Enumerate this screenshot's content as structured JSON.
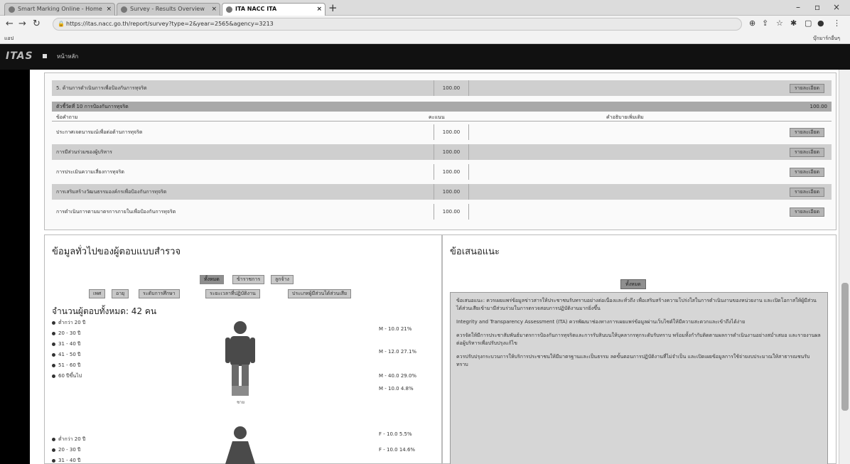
{
  "browser": {
    "tabs": [
      {
        "label": "Smart Marking Online - Home"
      },
      {
        "label": "Survey - Results Overview"
      },
      {
        "label": "ITA NACC ITA"
      }
    ],
    "url": "https://itas.nacc.go.th/report/survey?type=2&year=2565&agency=3213",
    "bookmark_left": "แอป",
    "bookmark_right": "บุ๊กมาร์กอื่นๆ"
  },
  "app": {
    "logo": "ITAS",
    "title": "หน้าหลัก"
  },
  "top_table": {
    "rows_a": [
      {
        "name": "5. ด้านการดำเนินการเพื่อป้องกันการทุจริต",
        "score": "100.00",
        "button": "รายละเอียด"
      }
    ],
    "section": {
      "title": "ตัวชี้วัดที่ 10 การป้องกันการทุจริต",
      "total": "100.00"
    },
    "columns": {
      "a": "ข้อคำถาม",
      "b": "คะแนน",
      "c": "คำอธิบายเพิ่มเติม"
    },
    "rows_b": [
      {
        "name": "ประกาศเจตนารมณ์เพื่อต่อต้านการทุจริต",
        "score": "100.00",
        "button": "รายละเอียด"
      },
      {
        "name": "การมีส่วนร่วมของผู้บริหาร",
        "score": "100.00",
        "button": "รายละเอียด"
      },
      {
        "name": "การประเมินความเสี่ยงการทุจริต",
        "score": "100.00",
        "button": "รายละเอียด"
      },
      {
        "name": "การเสริมสร้างวัฒนธรรมองค์กรเพื่อป้องกันการทุจริต",
        "score": "100.00",
        "button": "รายละเอียด"
      },
      {
        "name": "การดำเนินการตามมาตรการภายในเพื่อป้องกันการทุจริต",
        "score": "100.00",
        "button": "รายละเอียด"
      }
    ]
  },
  "left_panel": {
    "title": "ข้อมูลทั่วไปของผู้ตอบแบบสำรวจ",
    "filters_row1": [
      "ทั้งหมด",
      "ข้าราชการ",
      "ลูกจ้าง"
    ],
    "filters_row2": [
      "เพศ",
      "อายุ",
      "ระดับการศึกษา",
      "ระยะเวลาที่ปฏิบัติงาน",
      "ประเภทผู้มีส่วนได้ส่วนเสีย"
    ],
    "total_label": "จำนวนผู้ตอบทั้งหมด: 42 คน",
    "legend_male": [
      "ต่ำกว่า 20 ปี",
      "20 - 30 ปี",
      "31 - 40 ปี",
      "41 - 50 ปี",
      "51 - 60 ปี",
      "60 ปีขึ้นไป"
    ],
    "male_pcts": [
      "M - 10.0 21%",
      "M - 12.0 27.1%",
      "M - 40.0 29.0%",
      "M - 10.0 4.8%"
    ],
    "male_caption": "ชาย",
    "female_pcts": [
      "F - 10.0 5.5%",
      "F - 10.0 14.6%"
    ],
    "legend_female": [
      "ต่ำกว่า 20 ปี",
      "20 - 30 ปี",
      "31 - 40 ปี"
    ]
  },
  "right_panel": {
    "title": "ข้อเสนอแนะ",
    "button": "ทั้งหมด",
    "paragraphs": [
      "ข้อเสนอแนะ: ควรเผยแพร่ข้อมูลข่าวสารให้ประชาชนรับทราบอย่างต่อเนื่องและทั่วถึง เพื่อเสริมสร้างความโปร่งใสในการดำเนินงานของหน่วยงาน และเปิดโอกาสให้ผู้มีส่วนได้ส่วนเสียเข้ามามีส่วนร่วมในการตรวจสอบการปฏิบัติงานมากยิ่งขึ้น",
      "Integrity and Transparency Assessment (ITA) ควรพัฒนาช่องทางการเผยแพร่ข้อมูลผ่านเว็บไซต์ให้มีความสะดวกและเข้าถึงได้ง่าย",
      "ควรจัดให้มีการประชาสัมพันธ์มาตรการป้องกันการทุจริตและการรับสินบนให้บุคลากรทุกระดับรับทราบ พร้อมทั้งกำกับติดตามผลการดำเนินงานอย่างสม่ำเสมอ และรายงานผลต่อผู้บริหารเพื่อปรับปรุงแก้ไข",
      "ควรปรับปรุงกระบวนการให้บริการประชาชนให้มีมาตรฐานและเป็นธรรม ลดขั้นตอนการปฏิบัติงานที่ไม่จำเป็น และเปิดเผยข้อมูลการใช้จ่ายงบประมาณให้สาธารณชนรับทราบ"
    ]
  },
  "colors": {
    "header": "#111111",
    "row_shade": "#cfcfcf",
    "section": "#a9a9a9",
    "figure": "#4a4a4a"
  }
}
